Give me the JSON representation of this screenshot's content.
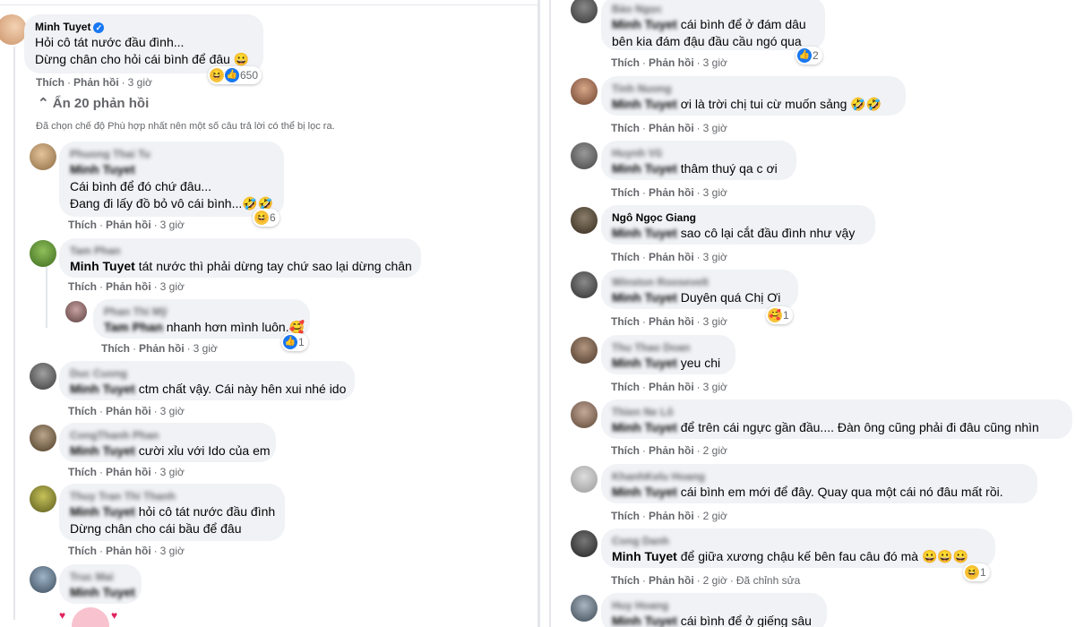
{
  "left": {
    "top_comment": {
      "author": "Minh Tuyet",
      "lines": [
        "Hỏi cô tát nước đầu đình...",
        "Dừng chân cho hỏi cái bình để đâu 😀"
      ],
      "reaction_count": "650",
      "actions": {
        "like": "Thích",
        "reply": "Phản hồi",
        "time": "3 giờ"
      }
    },
    "hide_replies": "Ẩn 20 phản hồi",
    "filter_notice": "Đã chọn chế độ Phù hợp nhất nên một số câu trả lời có thể bị lọc ra.",
    "replies": [
      {
        "author": "Phuong Thai Tu",
        "mention": "Minh Tuyet",
        "text": "",
        "lines": [
          "Cái bình để đó chứ đâu...",
          "Đang đi lấy đồ bỏ vô cái bình...🤣🤣"
        ],
        "reaction_count": "6",
        "like": "Thích",
        "reply": "Phản hồi",
        "time": "3 giờ"
      },
      {
        "author": "Tam Phan",
        "mention": "Minh Tuyet",
        "text": "tát nước thì phải dừng tay chứ sao lại dừng chân",
        "like": "Thích",
        "reply": "Phản hồi",
        "time": "3 giờ"
      },
      {
        "author": "Phan Thi Mỹ",
        "mention": "Tam Phan",
        "text": "nhanh hơn mình luôn.🥰",
        "reaction_count": "1",
        "like": "Thích",
        "reply": "Phản hồi",
        "time": "3 giờ"
      },
      {
        "author": "Duc Cuong",
        "mention": "Minh Tuyet",
        "text": "ctm chất vậy. Cái này hên xui nhé ido",
        "like": "Thích",
        "reply": "Phản hồi",
        "time": "3 giờ"
      },
      {
        "author": "CongThanh Phan",
        "mention": "Minh Tuyet",
        "text": "cười xỉu với Ido của em",
        "like": "Thích",
        "reply": "Phản hồi",
        "time": "3 giờ"
      },
      {
        "author": "Thuy Tran Thi Thanh",
        "mention": "Minh Tuyet",
        "text": "hỏi cô tát nước đầu đình",
        "line2": "Dừng chân cho cái bầu để đâu",
        "like": "Thích",
        "reply": "Phản hồi",
        "time": "3 giờ"
      },
      {
        "author": "Truc Mai",
        "mention": "Minh Tuyet",
        "text": ""
      }
    ]
  },
  "right": {
    "replies": [
      {
        "author": "Bảo Ngọc",
        "mention": "Minh Tuyet",
        "text": "cái bình để ở đám dâu",
        "line2": "bên kia đám đậu đầu cầu ngó qua",
        "reaction_count": "2",
        "like": "Thích",
        "reply": "Phản hồi",
        "time": "3 giờ"
      },
      {
        "author": "Tinh Nuong",
        "mention": "Minh Tuyet",
        "text": "ơi là trời chị tui cừ muốn sảng 🤣🤣",
        "like": "Thích",
        "reply": "Phản hồi",
        "time": "3 giờ"
      },
      {
        "author": "Huynh Vũ",
        "mention": "Minh Tuyet",
        "text": "thâm thuý qa c ơi",
        "like": "Thích",
        "reply": "Phản hồi",
        "time": "3 giờ"
      },
      {
        "author": "Ngô Ngọc Giang",
        "mention": "Minh Tuyet",
        "text": "sao cô lại cắt đầu đình như vậy",
        "like": "Thích",
        "reply": "Phản hồi",
        "time": "3 giờ"
      },
      {
        "author": "Winston Roosevelt",
        "mention": "Minh Tuyet",
        "text": "Duyên quá Chị Ơi",
        "reaction_count": "1",
        "like": "Thích",
        "reply": "Phản hồi",
        "time": "3 giờ"
      },
      {
        "author": "Thu Thao Doan",
        "mention": "Minh Tuyet",
        "text": "yeu chi",
        "like": "Thích",
        "reply": "Phản hồi",
        "time": "3 giờ"
      },
      {
        "author": "Thien Ne Lô",
        "mention": "Minh Tuyet",
        "text": "để trên cái ngực gần đầu.... Đàn ông cũng phải đi đâu cũng nhìn",
        "like": "Thích",
        "reply": "Phản hồi",
        "time": "2 giờ"
      },
      {
        "author": "KhanhKelu Hoang",
        "mention": "Minh Tuyet",
        "text": "cái bình em mới để đây. Quay qua một cái nó đâu mất rồi.",
        "like": "Thích",
        "reply": "Phản hồi",
        "time": "2 giờ"
      },
      {
        "author": "Cong Danh",
        "mention": "Minh Tuyet",
        "text": "để giữa xương chậu kế bên fau câu đó mà 😀😀😀",
        "reaction_count": "1",
        "like": "Thích",
        "reply": "Phản hồi",
        "time": "2 giờ",
        "edited": "Đã chỉnh sửa"
      },
      {
        "author": "Huy Hoang",
        "mention": "Minh Tuyet",
        "text": "cái bình để ở giếng sâu"
      }
    ]
  }
}
